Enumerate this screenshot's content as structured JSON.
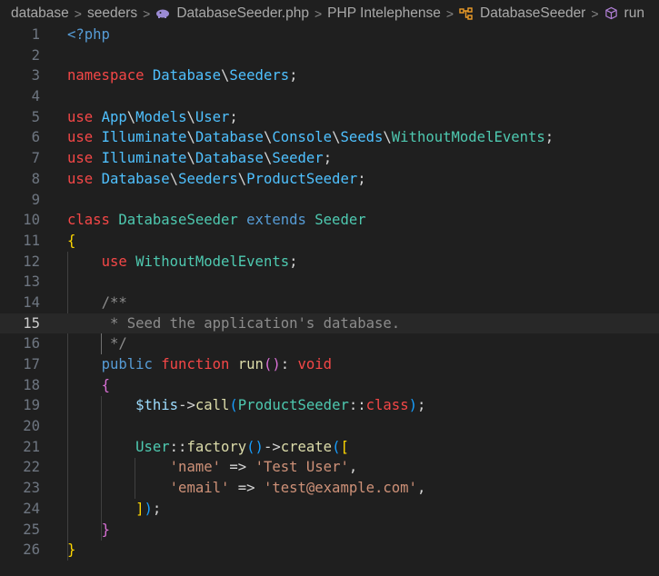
{
  "breadcrumb": {
    "items": [
      "database",
      "seeders",
      "DatabaseSeeder.php",
      "PHP Intelephense",
      "DatabaseSeeder",
      "run"
    ],
    "separator": ">"
  },
  "editor": {
    "active_line": 15,
    "lines": [
      {
        "n": "1",
        "tokens": [
          [
            "<?php",
            "t-tag"
          ]
        ]
      },
      {
        "n": "2",
        "tokens": []
      },
      {
        "n": "3",
        "tokens": [
          [
            "namespace ",
            "t-kw"
          ],
          [
            "Database",
            "t-ns"
          ],
          [
            "\\",
            "t-pun"
          ],
          [
            "Seeders",
            "t-ns"
          ],
          [
            ";",
            "t-pun"
          ]
        ]
      },
      {
        "n": "4",
        "tokens": []
      },
      {
        "n": "5",
        "tokens": [
          [
            "use ",
            "t-kw"
          ],
          [
            "App",
            "t-ns"
          ],
          [
            "\\",
            "t-pun"
          ],
          [
            "Models",
            "t-ns"
          ],
          [
            "\\",
            "t-pun"
          ],
          [
            "User",
            "t-ns"
          ],
          [
            ";",
            "t-pun"
          ]
        ]
      },
      {
        "n": "6",
        "tokens": [
          [
            "use ",
            "t-kw"
          ],
          [
            "Illuminate",
            "t-ns"
          ],
          [
            "\\",
            "t-pun"
          ],
          [
            "Database",
            "t-ns"
          ],
          [
            "\\",
            "t-pun"
          ],
          [
            "Console",
            "t-ns"
          ],
          [
            "\\",
            "t-pun"
          ],
          [
            "Seeds",
            "t-ns"
          ],
          [
            "\\",
            "t-pun"
          ],
          [
            "WithoutModelEvents",
            "t-cls"
          ],
          [
            ";",
            "t-pun"
          ]
        ]
      },
      {
        "n": "7",
        "tokens": [
          [
            "use ",
            "t-kw"
          ],
          [
            "Illuminate",
            "t-ns"
          ],
          [
            "\\",
            "t-pun"
          ],
          [
            "Database",
            "t-ns"
          ],
          [
            "\\",
            "t-pun"
          ],
          [
            "Seeder",
            "t-ns"
          ],
          [
            ";",
            "t-pun"
          ]
        ]
      },
      {
        "n": "8",
        "tokens": [
          [
            "use ",
            "t-kw"
          ],
          [
            "Database",
            "t-ns"
          ],
          [
            "\\",
            "t-pun"
          ],
          [
            "Seeders",
            "t-ns"
          ],
          [
            "\\",
            "t-pun"
          ],
          [
            "ProductSeeder",
            "t-ns"
          ],
          [
            ";",
            "t-pun"
          ]
        ]
      },
      {
        "n": "9",
        "tokens": []
      },
      {
        "n": "10",
        "tokens": [
          [
            "class ",
            "t-kw"
          ],
          [
            "DatabaseSeeder ",
            "t-cls"
          ],
          [
            "extends ",
            "t-blue"
          ],
          [
            "Seeder",
            "t-cls"
          ]
        ]
      },
      {
        "n": "11",
        "tokens": [
          [
            "{",
            "t-br1"
          ]
        ]
      },
      {
        "n": "12",
        "tokens": [
          [
            "    ",
            ""
          ],
          [
            "use ",
            "t-kw"
          ],
          [
            "WithoutModelEvents",
            "t-tr"
          ],
          [
            ";",
            "t-pun"
          ]
        ]
      },
      {
        "n": "13",
        "tokens": []
      },
      {
        "n": "14",
        "tokens": [
          [
            "    ",
            ""
          ],
          [
            "/**",
            "t-com"
          ]
        ]
      },
      {
        "n": "15",
        "tokens": [
          [
            "    ",
            ""
          ],
          [
            " * Seed the application's database.",
            "t-com"
          ]
        ]
      },
      {
        "n": "16",
        "tokens": [
          [
            "    ",
            ""
          ],
          [
            " */",
            "t-com"
          ]
        ]
      },
      {
        "n": "17",
        "tokens": [
          [
            "    ",
            ""
          ],
          [
            "public ",
            "t-blue"
          ],
          [
            "function ",
            "t-kw"
          ],
          [
            "run",
            "t-fn"
          ],
          [
            "()",
            "t-br2"
          ],
          [
            ": ",
            "t-pun"
          ],
          [
            "void",
            "t-kw"
          ]
        ]
      },
      {
        "n": "18",
        "tokens": [
          [
            "    ",
            ""
          ],
          [
            "{",
            "t-br2"
          ]
        ]
      },
      {
        "n": "19",
        "tokens": [
          [
            "        ",
            ""
          ],
          [
            "$this",
            "t-var"
          ],
          [
            "->",
            "t-pun"
          ],
          [
            "call",
            "t-fn"
          ],
          [
            "(",
            "t-br3"
          ],
          [
            "ProductSeeder",
            "t-cls"
          ],
          [
            "::",
            "t-pun"
          ],
          [
            "class",
            "t-kw"
          ],
          [
            ")",
            "t-br3"
          ],
          [
            ";",
            "t-pun"
          ]
        ]
      },
      {
        "n": "20",
        "tokens": []
      },
      {
        "n": "21",
        "tokens": [
          [
            "        ",
            ""
          ],
          [
            "User",
            "t-cls"
          ],
          [
            "::",
            "t-pun"
          ],
          [
            "factory",
            "t-fn"
          ],
          [
            "()",
            "t-br3"
          ],
          [
            "->",
            "t-pun"
          ],
          [
            "create",
            "t-fn"
          ],
          [
            "(",
            "t-br3"
          ],
          [
            "[",
            "t-br1"
          ]
        ]
      },
      {
        "n": "22",
        "tokens": [
          [
            "            ",
            ""
          ],
          [
            "'name'",
            "t-str"
          ],
          [
            " => ",
            "t-pun"
          ],
          [
            "'Test User'",
            "t-str"
          ],
          [
            ",",
            "t-pun"
          ]
        ]
      },
      {
        "n": "23",
        "tokens": [
          [
            "            ",
            ""
          ],
          [
            "'email'",
            "t-str"
          ],
          [
            " => ",
            "t-pun"
          ],
          [
            "'test@example.com'",
            "t-str"
          ],
          [
            ",",
            "t-pun"
          ]
        ]
      },
      {
        "n": "24",
        "tokens": [
          [
            "        ",
            ""
          ],
          [
            "]",
            "t-br1"
          ],
          [
            ")",
            "t-br3"
          ],
          [
            ";",
            "t-pun"
          ]
        ]
      },
      {
        "n": "25",
        "tokens": [
          [
            "    ",
            ""
          ],
          [
            "}",
            "t-br2"
          ]
        ]
      },
      {
        "n": "26",
        "tokens": [
          [
            "}",
            "t-br1"
          ]
        ]
      }
    ]
  }
}
